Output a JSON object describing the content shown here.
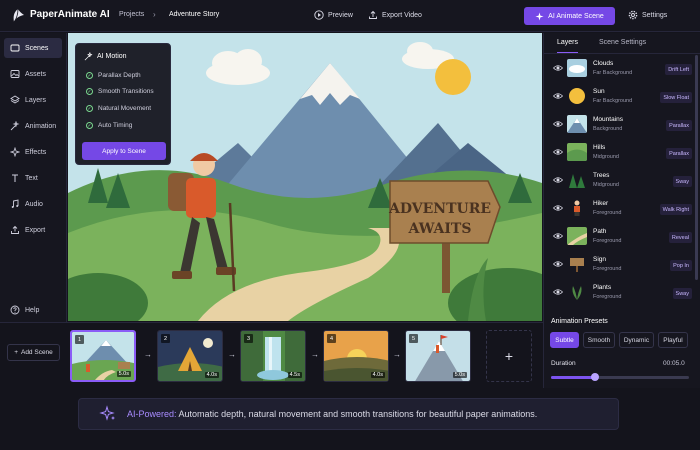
{
  "app": {
    "title": "PaperAnimate AI",
    "brand_color": "#7548e6"
  },
  "breadcrumb": {
    "projects": "Projects",
    "separator": "›",
    "current": "Adventure Story"
  },
  "topbar": {
    "preview": "Preview",
    "export": "Export Video",
    "ai_scene": "AI Animate Scene",
    "settings": "Settings"
  },
  "sidebar": {
    "items": [
      {
        "label": "Scenes",
        "icon": "scenes-icon",
        "active": true
      },
      {
        "label": "Assets",
        "icon": "assets-icon"
      },
      {
        "label": "Layers",
        "icon": "layers-icon"
      },
      {
        "label": "Animation",
        "icon": "animation-icon"
      },
      {
        "label": "Effects",
        "icon": "effects-icon"
      },
      {
        "label": "Text",
        "icon": "text-icon"
      },
      {
        "label": "Audio",
        "icon": "audio-icon"
      },
      {
        "label": "Export",
        "icon": "export-icon"
      }
    ],
    "help": "Help"
  },
  "ai_panel": {
    "title": "AI Motion",
    "options": [
      "Parallax Depth",
      "Smooth Transitions",
      "Natural Movement",
      "Auto Timing"
    ],
    "apply": "Apply to Scene"
  },
  "canvas": {
    "sign_line1": "ADVENTURE",
    "sign_line2": "AWAITS"
  },
  "right_panel": {
    "tabs": [
      "Layers",
      "Scene Settings"
    ],
    "layers": [
      {
        "name": "Clouds",
        "type": "Far Background",
        "animation": "Drift Left"
      },
      {
        "name": "Sun",
        "type": "Far Background",
        "animation": "Slow Float"
      },
      {
        "name": "Mountains",
        "type": "Background",
        "animation": "Parallax"
      },
      {
        "name": "Hills",
        "type": "Midground",
        "animation": "Parallax"
      },
      {
        "name": "Trees",
        "type": "Midground",
        "animation": "Sway"
      },
      {
        "name": "Hiker",
        "type": "Foreground",
        "animation": "Walk Right"
      },
      {
        "name": "Path",
        "type": "Foreground",
        "animation": "Reveal"
      },
      {
        "name": "Sign",
        "type": "Foreground",
        "animation": "Pop In"
      },
      {
        "name": "Plants",
        "type": "Foreground",
        "animation": "Sway"
      }
    ],
    "presets_title": "Animation Presets",
    "presets": [
      "Subtle",
      "Smooth",
      "Dynamic",
      "Playful"
    ],
    "active_preset": "Subtle",
    "duration_label": "Duration",
    "duration_value": "00:05.0",
    "duration_fraction": 0.32
  },
  "timeline": {
    "add_scene": "Add Scene",
    "scenes": [
      {
        "num": "1",
        "duration": "5.0s",
        "active": true
      },
      {
        "num": "2",
        "duration": "4.0s"
      },
      {
        "num": "3",
        "duration": "4.5s"
      },
      {
        "num": "4",
        "duration": "4.0s"
      },
      {
        "num": "5",
        "duration": "5.0s"
      }
    ],
    "add_icon": "+"
  },
  "banner": {
    "bold": "AI-Powered:",
    "text": "Automatic depth, natural movement and smooth transitions for beautiful paper animations."
  }
}
